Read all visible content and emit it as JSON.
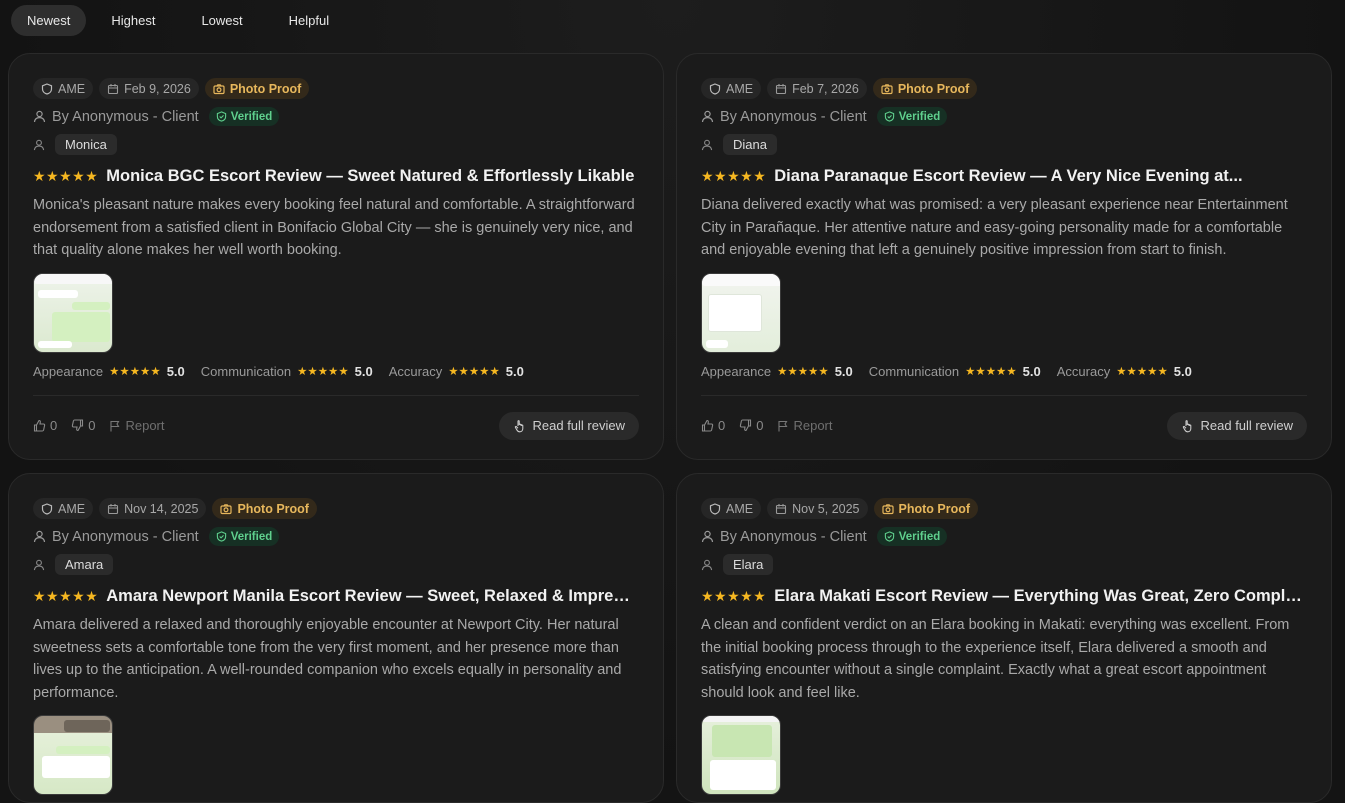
{
  "sort_tabs": [
    "Newest",
    "Highest",
    "Lowest",
    "Helpful"
  ],
  "reviews": [
    {
      "agency": "AME",
      "date": "Feb 9, 2026",
      "proof_label": "Photo Proof",
      "byline": "By Anonymous - Client",
      "verified_label": "Verified",
      "name": "Monica",
      "stars": "★★★★★",
      "title": "Monica BGC Escort Review — Sweet Natured & Effortlessly Likable",
      "body": "Monica's pleasant nature makes every booking feel natural and comfortable. A straightforward endorsement from a satisfied client in Bonifacio Global City — she is genuinely very nice, and that quality alone makes her well worth booking.",
      "ratings": [
        {
          "label": "Appearance",
          "stars": "★★★★★",
          "value": "5.0"
        },
        {
          "label": "Communication",
          "stars": "★★★★★",
          "value": "5.0"
        },
        {
          "label": "Accuracy",
          "stars": "★★★★★",
          "value": "5.0"
        }
      ],
      "likes": "0",
      "dislikes": "0",
      "report_label": "Report",
      "read_label": "Read full review"
    },
    {
      "agency": "AME",
      "date": "Feb 7, 2026",
      "proof_label": "Photo Proof",
      "byline": "By Anonymous - Client",
      "verified_label": "Verified",
      "name": "Diana",
      "stars": "★★★★★",
      "title": "Diana Paranaque Escort Review — A Very Nice Evening at...",
      "body": "Diana delivered exactly what was promised: a very pleasant experience near Entertainment City in Parañaque. Her attentive nature and easy-going personality made for a comfortable and enjoyable evening that left a genuinely positive impression from start to finish.",
      "ratings": [
        {
          "label": "Appearance",
          "stars": "★★★★★",
          "value": "5.0"
        },
        {
          "label": "Communication",
          "stars": "★★★★★",
          "value": "5.0"
        },
        {
          "label": "Accuracy",
          "stars": "★★★★★",
          "value": "5.0"
        }
      ],
      "likes": "0",
      "dislikes": "0",
      "report_label": "Report",
      "read_label": "Read full review"
    },
    {
      "agency": "AME",
      "date": "Nov 14, 2025",
      "proof_label": "Photo Proof",
      "byline": "By Anonymous - Client",
      "verified_label": "Verified",
      "name": "Amara",
      "stars": "★★★★★",
      "title": "Amara Newport Manila Escort Review — Sweet, Relaxed & Impressiv...",
      "body": "Amara delivered a relaxed and thoroughly enjoyable encounter at Newport City. Her natural sweetness sets a comfortable tone from the very first moment, and her presence more than lives up to the anticipation. A well-rounded companion who excels equally in personality and performance."
    },
    {
      "agency": "AME",
      "date": "Nov 5, 2025",
      "proof_label": "Photo Proof",
      "byline": "By Anonymous - Client",
      "verified_label": "Verified",
      "name": "Elara",
      "stars": "★★★★★",
      "title": "Elara Makati Escort Review — Everything Was Great, Zero Complaints",
      "body": "A clean and confident verdict on an Elara booking in Makati: everything was excellent. From the initial booking process through to the experience itself, Elara delivered a smooth and satisfying encounter without a single complaint. Exactly what a great escort appointment should look and feel like."
    }
  ]
}
